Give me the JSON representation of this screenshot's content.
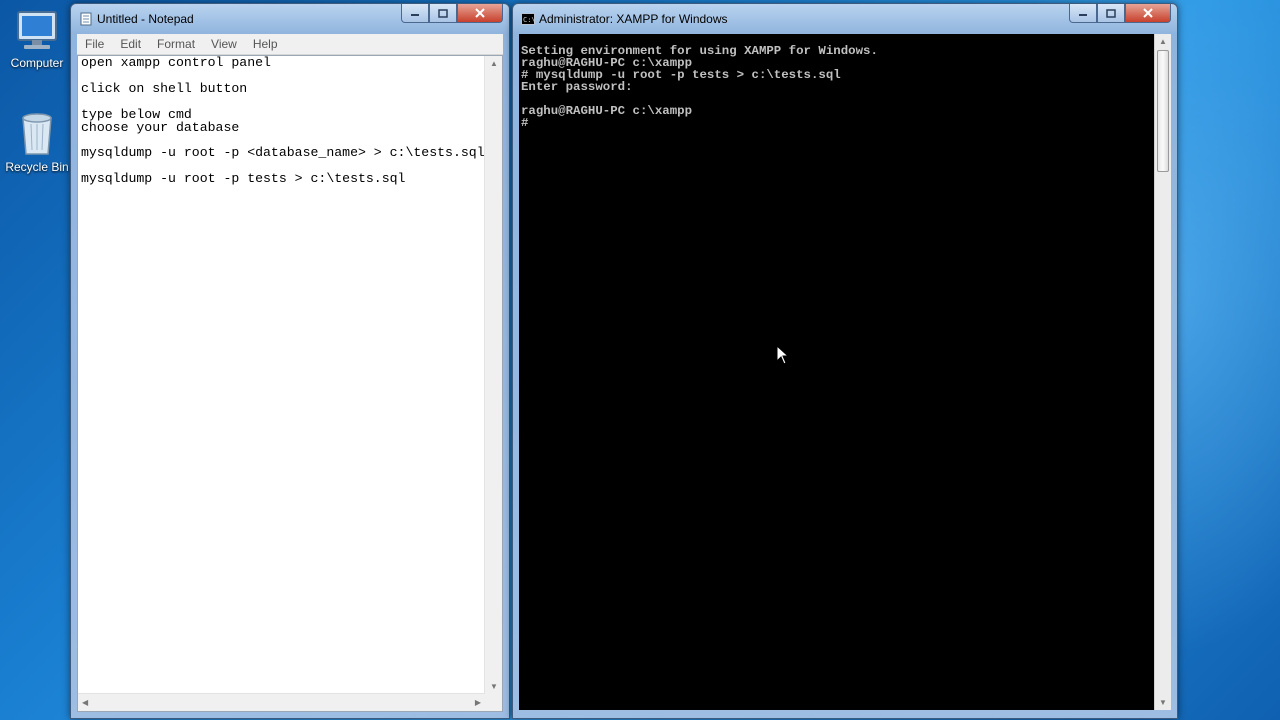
{
  "desktop": {
    "icons": [
      {
        "label": "Computer"
      },
      {
        "label": "Recycle Bin"
      }
    ]
  },
  "notepad": {
    "title": "Untitled - Notepad",
    "menu": [
      "File",
      "Edit",
      "Format",
      "View",
      "Help"
    ],
    "content": "open xampp control panel\n\nclick on shell button\n\ntype below cmd\nchoose your database\n\nmysqldump -u root -p <database_name> > c:\\tests.sql\n\nmysqldump -u root -p tests > c:\\tests.sql"
  },
  "console": {
    "title": "Administrator: XAMPP for Windows",
    "output": "Setting environment for using XAMPP for Windows.\nraghu@RAGHU-PC c:\\xampp\n# mysqldump -u root -p tests > c:\\tests.sql\nEnter password:\n\nraghu@RAGHU-PC c:\\xampp\n#"
  },
  "colors": {
    "console_bg": "#000000",
    "console_fg": "#c0c0c0",
    "desktop_blue": "#1a7fd1"
  },
  "icons": {
    "notepad": "notepad-icon",
    "console": "cmd-icon",
    "computer": "computer-icon",
    "recycle": "recycle-bin-icon"
  }
}
